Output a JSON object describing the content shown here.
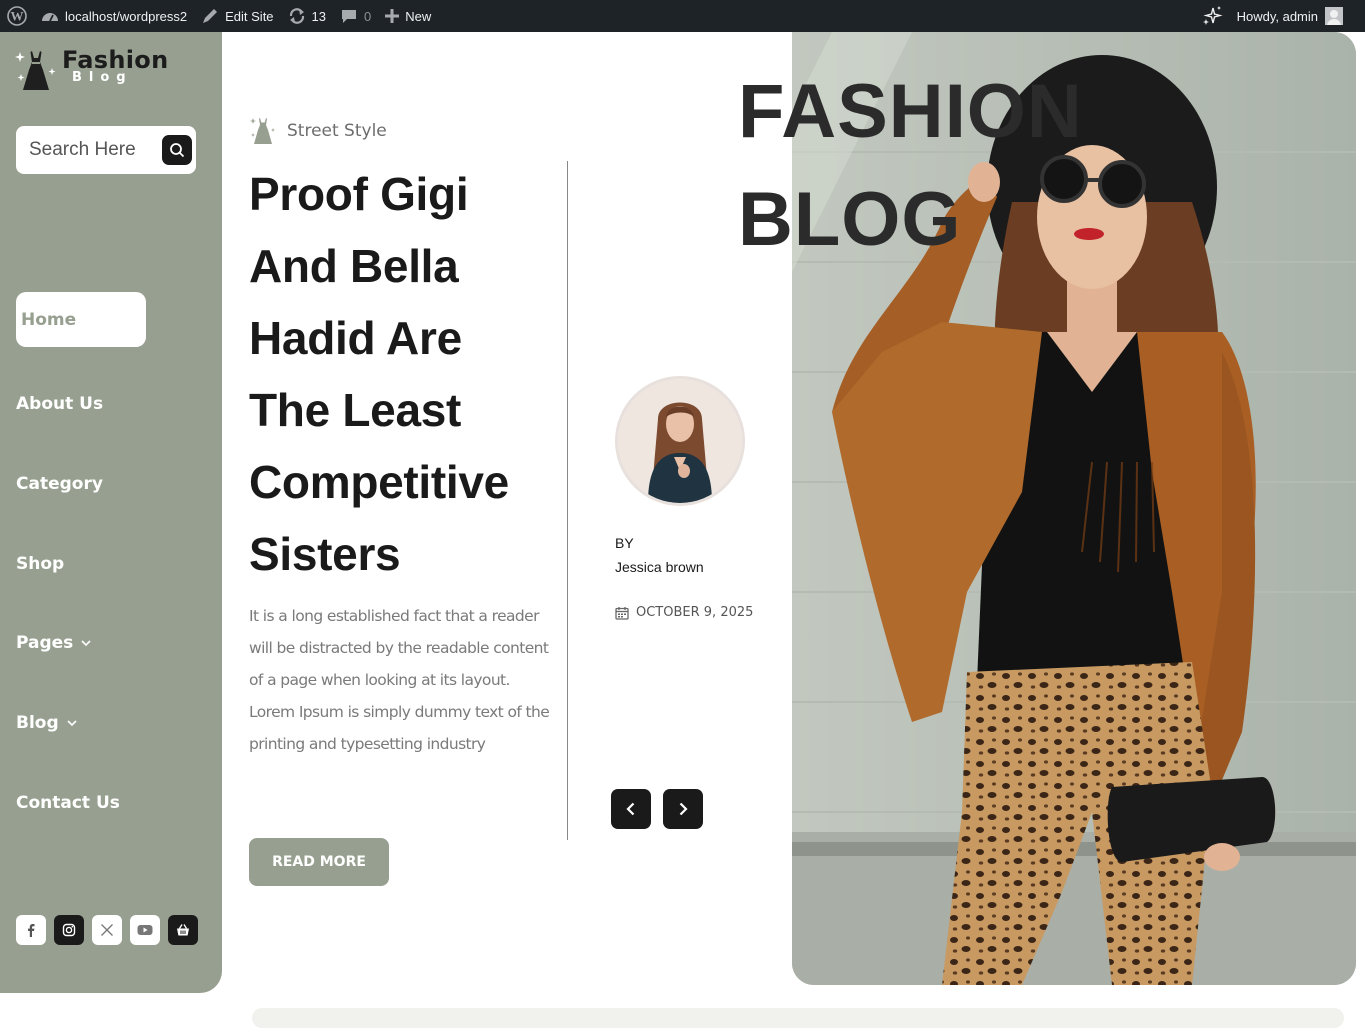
{
  "admin_bar": {
    "site_url": "localhost/wordpress2",
    "edit_site": "Edit Site",
    "updates_count": "13",
    "comments_count": "0",
    "new_label": "New",
    "greeting": "Howdy, admin"
  },
  "sidebar": {
    "logo_title": "Fashion",
    "logo_subtitle": "Blog",
    "search_placeholder": "Search Here",
    "nav": [
      {
        "label": "Home",
        "active": true
      },
      {
        "label": "About Us"
      },
      {
        "label": "Category"
      },
      {
        "label": "Shop"
      },
      {
        "label": "Pages",
        "has_dropdown": true
      },
      {
        "label": "Blog",
        "has_dropdown": true
      },
      {
        "label": "Contact Us"
      }
    ],
    "socials": [
      "facebook-icon",
      "instagram-icon",
      "x-twitter-icon",
      "youtube-icon",
      "basket-icon"
    ]
  },
  "post": {
    "category": "Street Style",
    "title": "Proof Gigi And Bella Hadid Are The Least Competitive Sisters",
    "excerpt": "It is a long established fact that a reader will be distracted by the readable content of a page when looking at its layout. Lorem Ipsum is simply dummy text of the printing and typesetting industry",
    "read_more": "READ MORE",
    "by_label": "BY",
    "author": "Jessica brown",
    "date": "OCTOBER 9, 2025"
  },
  "hero": {
    "heading_line1": "FASHION",
    "heading_line2": "BLOG"
  },
  "colors": {
    "sage": "#97a090",
    "dark": "#1a1a1a",
    "admin_bar": "#1d2327"
  }
}
